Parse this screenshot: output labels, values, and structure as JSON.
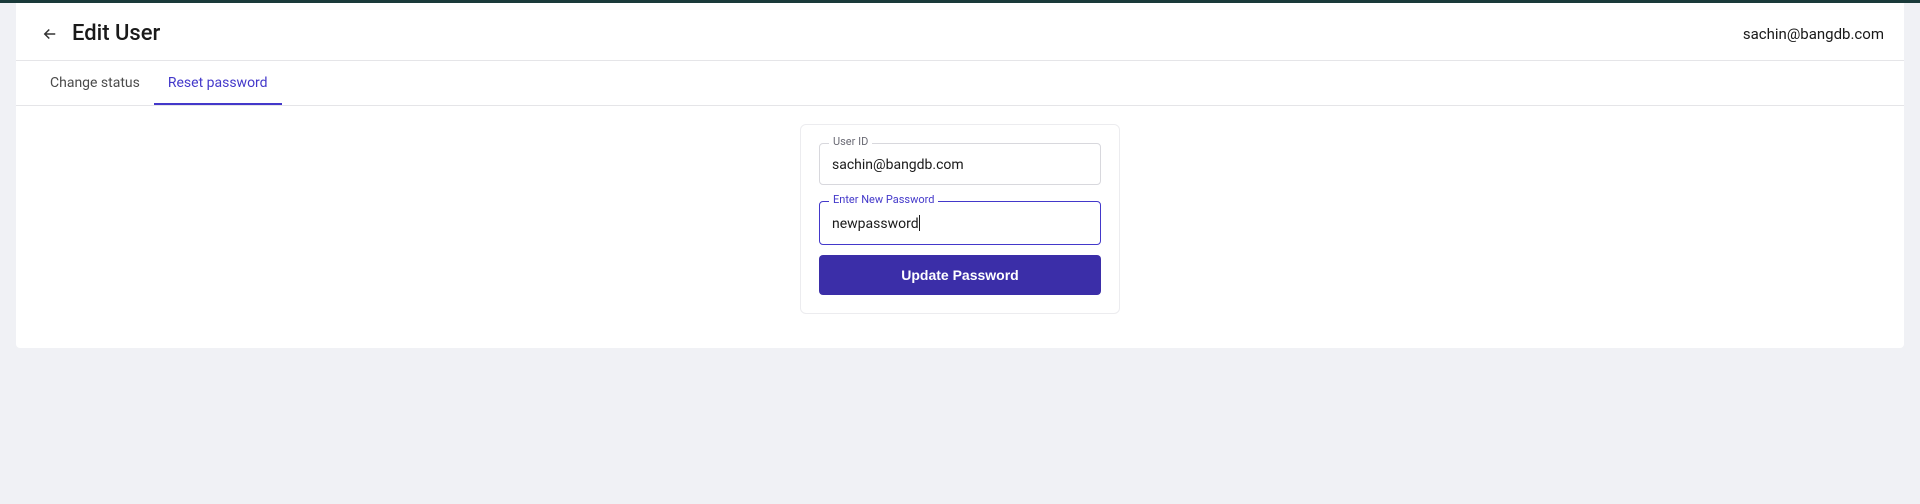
{
  "header": {
    "title": "Edit User",
    "user_email": "sachin@bangdb.com"
  },
  "tabs": {
    "change_status": "Change status",
    "reset_password": "Reset password"
  },
  "form": {
    "user_id_label": "User ID",
    "user_id_value": "sachin@bangdb.com",
    "password_label": "Enter New Password",
    "password_value": "newpassword",
    "update_button": "Update Password"
  }
}
